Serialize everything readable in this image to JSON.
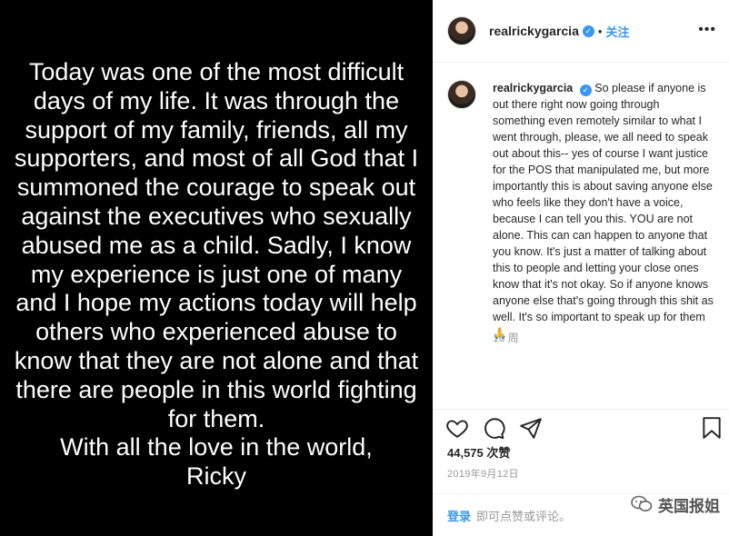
{
  "image_text": {
    "lines": [
      "Today was one of the most difficult",
      "days of my life. It was through the",
      "support of my family, friends, all my",
      "supporters, and most of all God that I",
      "summoned the courage to speak out",
      "against the executives who sexually",
      "abused me as a child. Sadly, I know",
      "my experience is just one of many",
      "and I hope my actions today will help",
      "others who experienced abuse to",
      "know that they are not alone and that",
      "there are people in this world fighting",
      "for them.",
      "With all the love in the world,",
      "Ricky"
    ]
  },
  "header": {
    "username": "realrickygarcia",
    "verified_mark": "✓",
    "separator": "•",
    "follow_label": "关注",
    "more_label": "•••"
  },
  "caption": {
    "username": "realrickygarcia",
    "text": "So please if anyone is out there right now going through something even remotely similar to what I went through, please, we all need to speak out about this-- yes of course I want justice for the POS that manipulated me, but more importantly this is about saving anyone else who feels like they don't have a voice, because I can tell you this. YOU are not alone. This can can happen to anyone that you know. It's just a matter of talking about this to people and letting your close ones know that it's not okay. So if anyone knows anyone else that's going through this shit as well. It's so important to speak up for them🙏",
    "time_ago": "16 周"
  },
  "actions": {
    "icons": [
      "heart-icon",
      "comment-icon",
      "share-icon",
      "bookmark-icon"
    ]
  },
  "likes_text": "44,575 次赞",
  "date_text": "2019年9月12日",
  "comment_bar": {
    "login_label": "登录",
    "hint": "即可点赞或评论。"
  },
  "watermark": {
    "text": "英国报姐"
  },
  "colors": {
    "accent": "#3897f0",
    "text": "#262626",
    "muted": "#999999",
    "image_bg": "#000000"
  }
}
